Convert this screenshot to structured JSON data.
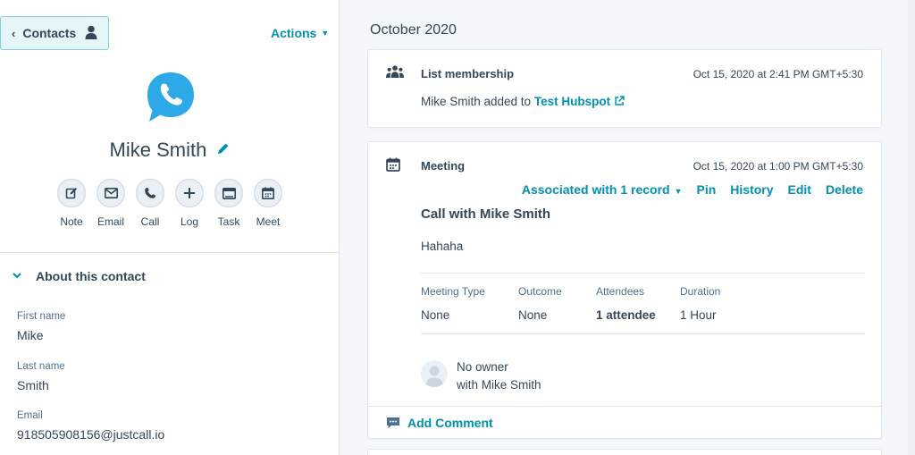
{
  "sidebar": {
    "back_label": "Contacts",
    "actions_label": "Actions",
    "contact_name": "Mike Smith",
    "activity_buttons": [
      {
        "label": "Note",
        "icon": "note-icon"
      },
      {
        "label": "Email",
        "icon": "email-icon"
      },
      {
        "label": "Call",
        "icon": "call-icon"
      },
      {
        "label": "Log",
        "icon": "log-icon"
      },
      {
        "label": "Task",
        "icon": "task-icon"
      },
      {
        "label": "Meet",
        "icon": "meet-icon"
      }
    ],
    "about_title": "About this contact",
    "fields": [
      {
        "label": "First name",
        "value": "Mike"
      },
      {
        "label": "Last name",
        "value": "Smith"
      },
      {
        "label": "Email",
        "value": "918505908156@justcall.io"
      }
    ]
  },
  "timeline": {
    "month": "October 2020",
    "list_card": {
      "title": "List membership",
      "time": "Oct 15, 2020 at 2:41 PM GMT+5:30",
      "text_prefix": "Mike Smith added to",
      "list_link": "Test Hubspot"
    },
    "meeting_card": {
      "title": "Meeting",
      "time": "Oct 15, 2020 at 1:00 PM GMT+5:30",
      "associated": "Associated with 1 record",
      "pin": "Pin",
      "history": "History",
      "edit": "Edit",
      "delete": "Delete",
      "call_title": "Call with Mike Smith",
      "body": "Hahaha",
      "columns": [
        {
          "header": "Meeting Type",
          "value": "None"
        },
        {
          "header": "Outcome",
          "value": "None"
        },
        {
          "header": "Attendees",
          "value": "1 attendee"
        },
        {
          "header": "Duration",
          "value": "1 Hour"
        }
      ],
      "owner": "No owner",
      "owner_with": "with Mike Smith",
      "add_comment": "Add Comment"
    }
  },
  "colors": {
    "accent": "#0091ae",
    "text": "#33475b",
    "avatar_blue": "#2da9e8",
    "background": "#f5f8fa"
  }
}
